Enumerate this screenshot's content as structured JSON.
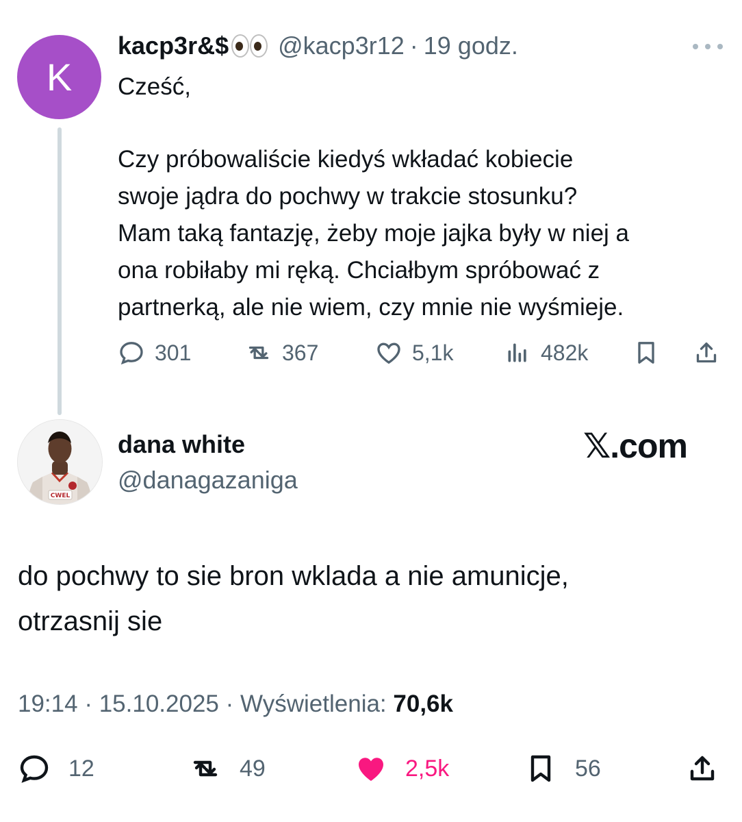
{
  "parent": {
    "avatar_letter": "K",
    "avatar_color": "#a64fc8",
    "display_name": "kacp3r&$",
    "handle": "@kacp3r12",
    "separator": "·",
    "time": "19 godz.",
    "greeting": "Cześć,",
    "body_lines": [
      "Czy próbowaliście kiedyś wkładać kobiecie",
      "swoje jądra do pochwy w trakcie stosunku?",
      "Mam taką fantazję, żeby moje jajka były w niej a",
      "ona robiłaby mi ręką. Chciałbym spróbować z",
      "partnerką, ale nie wiem, czy mnie nie wyśmieje."
    ],
    "stats": {
      "replies": "301",
      "reposts": "367",
      "likes": "5,1k",
      "views": "482k"
    },
    "icons": [
      "reply-icon",
      "repost-icon",
      "like-icon",
      "views-icon",
      "bookmark-icon",
      "share-icon"
    ]
  },
  "reply": {
    "display_name": "dana white",
    "handle": "@danagazaniga",
    "avatar_shirt_text": "CWEL",
    "watermark": "𝕏.com",
    "body_lines": [
      "do pochwy to sie bron wklada a nie amunicje,",
      "otrzasnij sie"
    ],
    "time": "19:14",
    "date": "15.10.2025",
    "separator": "·",
    "views_label": "Wyświetlenia:",
    "views_value": "70,6k",
    "stats": {
      "replies": "12",
      "reposts": "49",
      "likes": "2,5k",
      "bookmarks": "56"
    },
    "liked": true,
    "like_color": "#f91880"
  }
}
